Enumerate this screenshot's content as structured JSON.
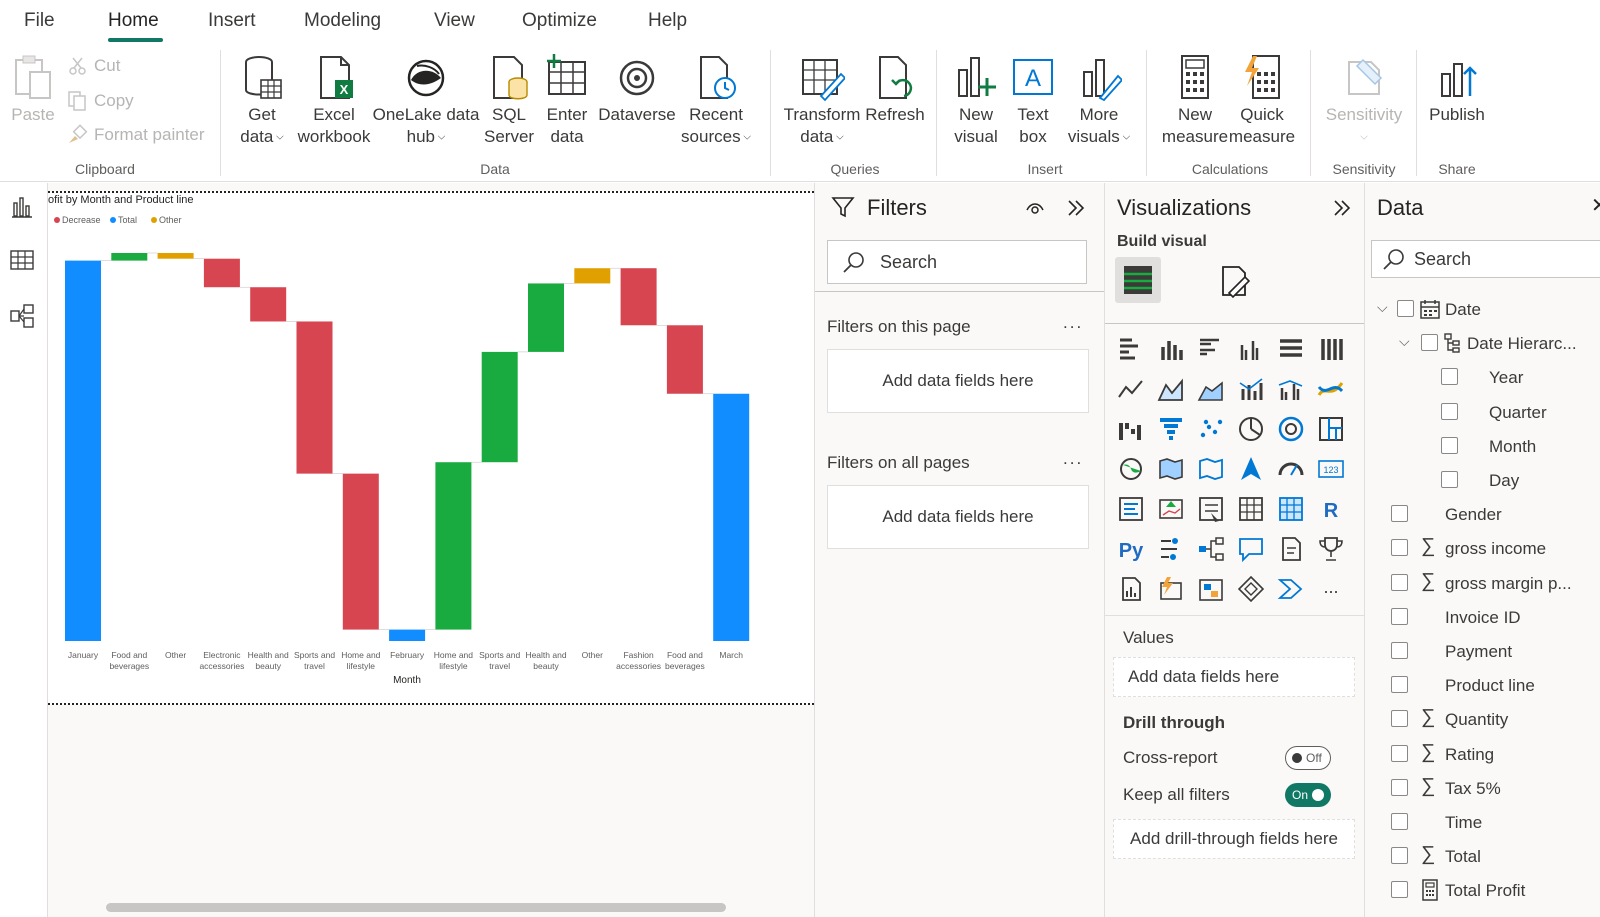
{
  "tabs": [
    "File",
    "Home",
    "Insert",
    "Modeling",
    "View",
    "Optimize",
    "Help"
  ],
  "ribbon": {
    "clipboard": {
      "paste": "Paste",
      "cut": "Cut",
      "copy": "Copy",
      "format_painter": "Format painter",
      "label": "Clipboard"
    },
    "data": {
      "get_data": [
        "Get",
        "data"
      ],
      "excel": [
        "Excel",
        "workbook"
      ],
      "onelake": [
        "OneLake data",
        "hub"
      ],
      "sql": [
        "SQL",
        "Server"
      ],
      "enter": [
        "Enter",
        "data"
      ],
      "dataverse": "Dataverse",
      "recent": [
        "Recent",
        "sources"
      ],
      "label": "Data"
    },
    "queries": {
      "transform": [
        "Transform",
        "data"
      ],
      "refresh": "Refresh",
      "label": "Queries"
    },
    "insert": {
      "new_visual": [
        "New",
        "visual"
      ],
      "text_box": [
        "Text",
        "box"
      ],
      "more_visuals": [
        "More",
        "visuals"
      ],
      "label": "Insert"
    },
    "calculations": {
      "new_measure": [
        "New",
        "measure"
      ],
      "quick_measure": [
        "Quick",
        "measure"
      ],
      "label": "Calculations"
    },
    "sensitivity": {
      "sensitivity": "Sensitivity",
      "label": "Sensitivity"
    },
    "share": {
      "publish": "Publish",
      "label": "Share"
    }
  },
  "chart_data": {
    "type": "waterfall",
    "title": "ofit by Month and Product line",
    "xlabel": "Month",
    "legend": [
      {
        "name": "Decrease",
        "color": "#d64550"
      },
      {
        "name": "Total",
        "color": "#118dff"
      },
      {
        "name": "Other",
        "color": "#e0a100"
      }
    ],
    "legend_placement": "top-left",
    "categories": [
      [
        "January"
      ],
      [
        "Food and",
        "beverages"
      ],
      [
        "Other"
      ],
      [
        "Electronic",
        "accessories"
      ],
      [
        "Health and",
        "beauty"
      ],
      [
        "Sports and",
        "travel"
      ],
      [
        "Home and",
        "lifestyle"
      ],
      [
        "February"
      ],
      [
        "Home and",
        "lifestyle"
      ],
      [
        "Sports and",
        "travel"
      ],
      [
        "Health and",
        "beauty"
      ],
      [
        "Other"
      ],
      [
        "Fashion",
        "accessories"
      ],
      [
        "Food and",
        "beverages"
      ],
      [
        "March"
      ]
    ],
    "bars": [
      {
        "start": 0,
        "end": 100,
        "kind": "total"
      },
      {
        "start": 100,
        "end": 102,
        "kind": "increase"
      },
      {
        "start": 102,
        "end": 100.5,
        "kind": "other"
      },
      {
        "start": 100.5,
        "end": 93,
        "kind": "decrease"
      },
      {
        "start": 93,
        "end": 84,
        "kind": "decrease"
      },
      {
        "start": 84,
        "end": 44,
        "kind": "decrease"
      },
      {
        "start": 44,
        "end": 3,
        "kind": "decrease"
      },
      {
        "start": 0,
        "end": 3,
        "kind": "total"
      },
      {
        "start": 3,
        "end": 47,
        "kind": "increase"
      },
      {
        "start": 47,
        "end": 76,
        "kind": "increase"
      },
      {
        "start": 76,
        "end": 94,
        "kind": "increase"
      },
      {
        "start": 94,
        "end": 98,
        "kind": "other"
      },
      {
        "start": 98,
        "end": 83,
        "kind": "decrease"
      },
      {
        "start": 83,
        "end": 65,
        "kind": "decrease"
      },
      {
        "start": 0,
        "end": 65,
        "kind": "total"
      }
    ],
    "colors": {
      "total": "#118dff",
      "increase": "#1aab40",
      "decrease": "#d64550",
      "other": "#e0a100"
    },
    "ylim": [
      0,
      102
    ],
    "grid": false
  },
  "filters": {
    "title": "Filters",
    "search_placeholder": "Search",
    "on_this_page": "Filters on this page",
    "on_all_pages": "Filters on all pages",
    "add_fields": "Add data fields here",
    "more": "..."
  },
  "visualizations": {
    "title": "Visualizations",
    "build_visual": "Build visual",
    "values_label": "Values",
    "add_fields": "Add data fields here",
    "drill_through": "Drill through",
    "cross_report": "Cross-report",
    "cross_report_state": "Off",
    "keep_all_filters": "Keep all filters",
    "keep_all_filters_state": "On",
    "add_drill": "Add drill-through fields here",
    "py": "Py",
    "r": "R",
    "more": "..."
  },
  "data_pane": {
    "title": "Data",
    "search_placeholder": "Search",
    "fields": [
      "Date",
      "Date Hierarc...",
      "Year",
      "Quarter",
      "Month",
      "Day",
      "Gender",
      "gross income",
      "gross margin p...",
      "Invoice ID",
      "Payment",
      "Product line",
      "Quantity",
      "Rating",
      "Tax 5%",
      "Time",
      "Total",
      "Total Profit"
    ]
  },
  "accent": "#117865"
}
